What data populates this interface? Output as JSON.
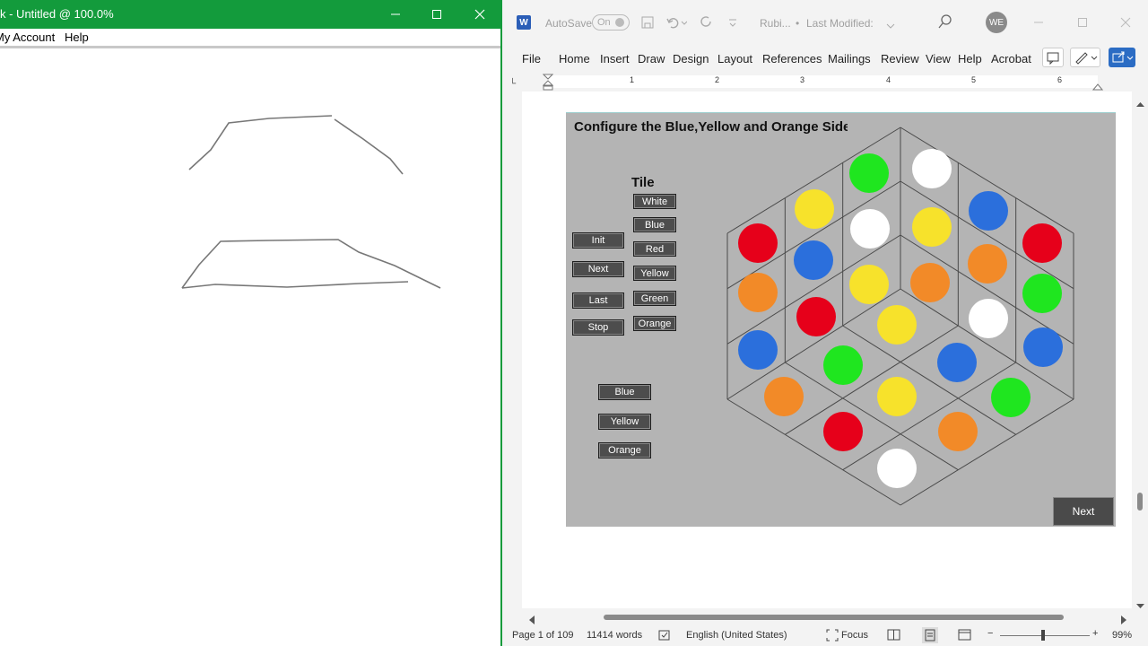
{
  "left_app": {
    "title": "k - Untitled @ 100.0%",
    "menu": [
      "My Account",
      "Help"
    ]
  },
  "word": {
    "titlebar": {
      "autosave_label": "AutoSave",
      "autosave_state": "On",
      "doc_name": "Rubi...",
      "last_modified": "Last Modified: ",
      "avatar_initials": "WE"
    },
    "tabs": [
      "File",
      "Home",
      "Insert",
      "Draw",
      "Design",
      "Layout",
      "References",
      "Mailings",
      "Review",
      "View",
      "Help",
      "Acrobat"
    ],
    "ruler_numbers": [
      "1",
      "2",
      "3",
      "4",
      "5",
      "6"
    ],
    "status": {
      "page": "Page 1 of 109",
      "words": "11414 words",
      "language": "English (United States)",
      "focus": "Focus",
      "zoom": "99%"
    }
  },
  "rubik_app": {
    "title": "Configure the Blue,Yellow and Orange Side",
    "tile_label": "Tile",
    "tile_buttons": [
      "White",
      "Blue",
      "Red",
      "Yellow",
      "Green",
      "Orange"
    ],
    "control_buttons": [
      "Init",
      "Next",
      "Last",
      "Stop"
    ],
    "side_buttons": [
      "Blue",
      "Yellow",
      "Orange"
    ],
    "next_button": "Next",
    "colors": {
      "white": "#ffffff",
      "blue": "#2b6fdc",
      "red": "#e6001a",
      "yellow": "#f7e22b",
      "green": "#1fe61f",
      "orange": "#f28a28"
    },
    "cube_tiles": [
      "green",
      "white",
      "yellow",
      "blue",
      "red",
      "white",
      "yellow",
      "red",
      "blue",
      "orange",
      "orange",
      "green",
      "red",
      "yellow",
      "orange",
      "yellow",
      "white",
      "blue",
      "blue",
      "green",
      "blue",
      "orange",
      "yellow",
      "green",
      "red",
      "orange",
      "white"
    ]
  }
}
